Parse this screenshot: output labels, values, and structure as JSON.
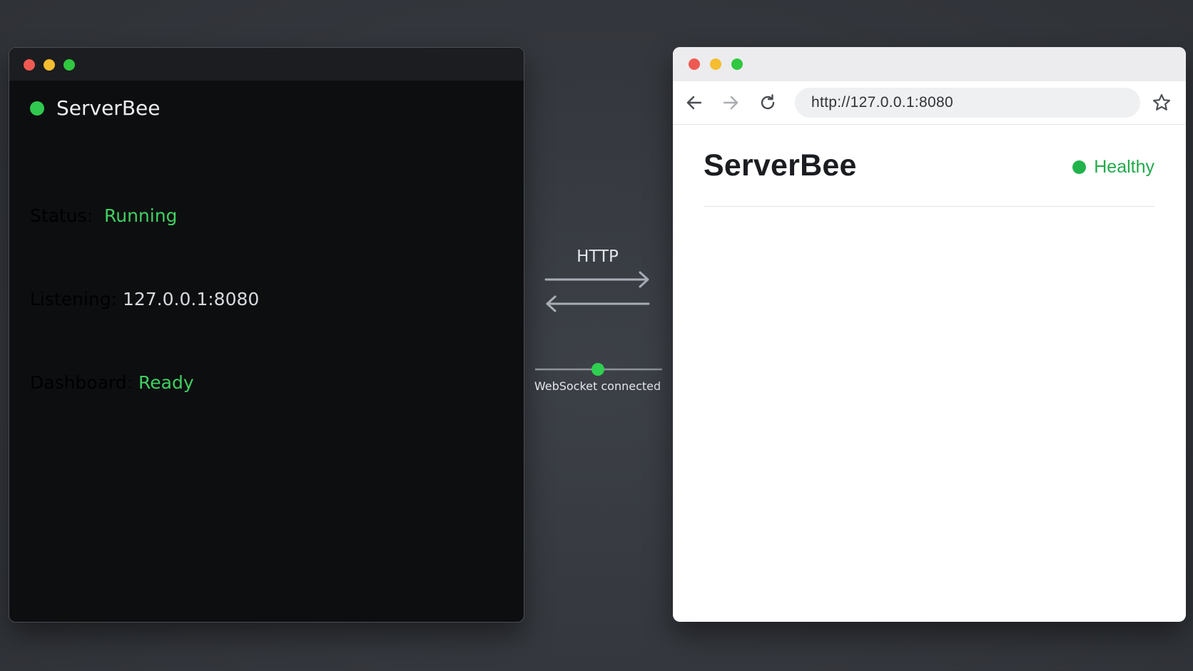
{
  "terminal": {
    "title": "ServerBee",
    "lines": [
      {
        "label": "Status:  ",
        "value": "Running"
      },
      {
        "label": "Listening: ",
        "value": "127.0.0.1:8080"
      },
      {
        "label": "Dashboard: ",
        "value": "Ready"
      }
    ]
  },
  "connector": {
    "protocol_label": "HTTP",
    "websocket_label": "WebSocket connected"
  },
  "browser": {
    "url": "http://127.0.0.1:8080",
    "site_title": "ServerBee",
    "health_status": "Healthy"
  },
  "colors": {
    "status_green": "#3fd160",
    "healthy_green": "#22a94a",
    "close": "#ee5a52",
    "minimize": "#f5bd2f",
    "maximize": "#2fc840"
  },
  "icons": [
    "back-arrow-icon",
    "forward-arrow-icon",
    "reload-icon",
    "star-icon"
  ]
}
